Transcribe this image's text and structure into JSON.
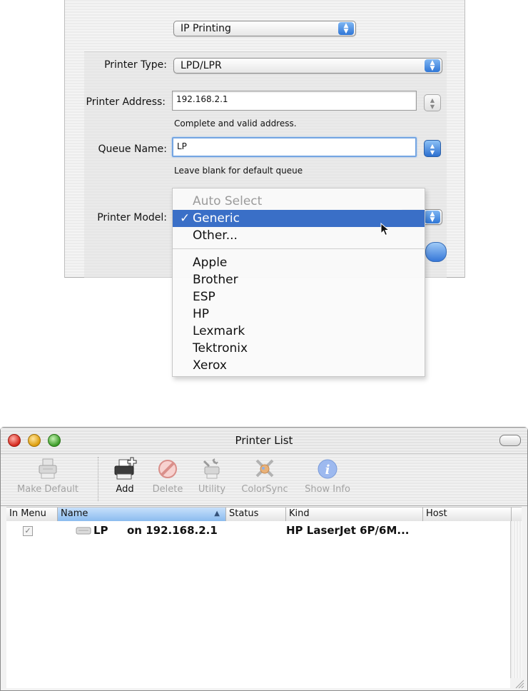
{
  "dialog": {
    "protocol_popup": "IP Printing",
    "printer_type": {
      "label": "Printer Type:",
      "value": "LPD/LPR"
    },
    "printer_address": {
      "label": "Printer Address:",
      "value": "192.168.2.1",
      "hint": "Complete and valid address."
    },
    "queue_name": {
      "label": "Queue Name:",
      "value": "LP",
      "hint": "Leave blank for default queue"
    },
    "printer_model": {
      "label": "Printer Model:"
    },
    "model_menu": {
      "items": [
        {
          "label": "Auto Select",
          "state": "disabled"
        },
        {
          "label": "Generic",
          "state": "selected",
          "checked": true
        },
        {
          "label": "Other...",
          "state": "normal"
        },
        {
          "label": "Apple",
          "state": "normal"
        },
        {
          "label": "Brother",
          "state": "normal"
        },
        {
          "label": "ESP",
          "state": "normal"
        },
        {
          "label": "HP",
          "state": "normal"
        },
        {
          "label": "Lexmark",
          "state": "normal"
        },
        {
          "label": "Tektronix",
          "state": "normal"
        },
        {
          "label": "Xerox",
          "state": "normal"
        }
      ],
      "check_glyph": "✓"
    },
    "accent_color": "#3a6fc7"
  },
  "printer_list": {
    "title": "Printer List",
    "toolbar": [
      {
        "label": "Make Default",
        "icon": "printer-default-icon",
        "enabled": false
      },
      {
        "label": "Add",
        "icon": "add-printer-icon",
        "enabled": true
      },
      {
        "label": "Delete",
        "icon": "delete-icon",
        "enabled": false
      },
      {
        "label": "Utility",
        "icon": "utility-icon",
        "enabled": false
      },
      {
        "label": "ColorSync",
        "icon": "colorsync-icon",
        "enabled": false
      },
      {
        "label": "Show Info",
        "icon": "info-icon",
        "enabled": false
      }
    ],
    "columns": [
      "In Menu",
      "Name",
      "Status",
      "Kind",
      "Host"
    ],
    "sorted_column": "Name",
    "rows": [
      {
        "in_menu": true,
        "name": "LP",
        "location": "on 192.168.2.1",
        "status": "",
        "kind": "HP LaserJet 6P/6M...",
        "host": ""
      }
    ]
  }
}
